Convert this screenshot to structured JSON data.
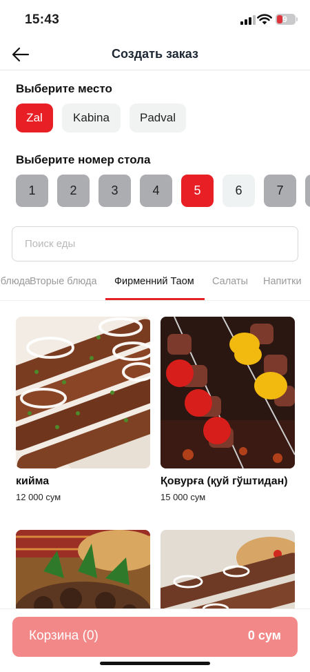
{
  "status_bar": {
    "time": "15:43",
    "battery": "9"
  },
  "header": {
    "title": "Создать заказ",
    "back_icon": "arrow-left-icon"
  },
  "place": {
    "title": "Выберите место",
    "options": [
      "Zal",
      "Kabina",
      "Padval"
    ],
    "selected": "Zal"
  },
  "table": {
    "title": "Выберите номер стола",
    "numbers": [
      "1",
      "2",
      "3",
      "4",
      "5",
      "6",
      "7"
    ],
    "selected": "5"
  },
  "search": {
    "placeholder": "Поиск еды",
    "value": ""
  },
  "categories": {
    "tabs": [
      "Первые блюда",
      "Вторые блюда",
      "Фирменний Таом",
      "Салаты",
      "Напитки"
    ],
    "active": "Фирменний Таом"
  },
  "products": [
    {
      "name": "кийма",
      "price": "12 000 сум"
    },
    {
      "name": "Қовурға (қуй гўштидан)",
      "price": "15 000 сум"
    },
    {
      "name": "",
      "price": ""
    },
    {
      "name": "",
      "price": ""
    }
  ],
  "cart": {
    "label": "Корзина (0)",
    "total": "0 сум"
  },
  "colors": {
    "accent": "#e81f24",
    "cart_button": "#f28888",
    "table_occupied": "#acadb1",
    "chip_bg": "#f1f3f3"
  }
}
